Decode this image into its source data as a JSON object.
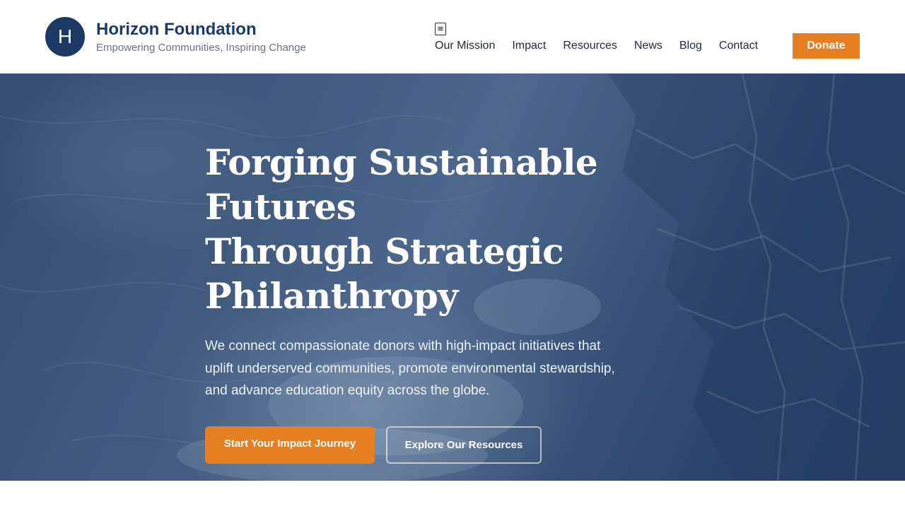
{
  "header": {
    "logo_letter": "H",
    "brand_name": "Horizon Foundation",
    "tagline": "Empowering Communities, Inspiring Change",
    "menu_toggle": "≡",
    "nav": [
      "Our Mission",
      "Impact",
      "Resources",
      "News",
      "Blog",
      "Contact"
    ],
    "donate_label": "Donate"
  },
  "hero": {
    "title_lines": [
      "Forging Sustainable Futures",
      "Through Strategic",
      "Philanthropy"
    ],
    "subtitle": "We connect compassionate donors with high-impact initiatives that uplift underserved communities, promote environmental stewardship, and advance education equity across the globe.",
    "primary_cta": "Start Your Impact Journey",
    "secondary_cta": "Explore Our Resources"
  },
  "colors": {
    "brand_navy": "#1b3a66",
    "accent_orange": "#e67e22",
    "hero_tint": "#3c5477"
  },
  "icons": {
    "menu_toggle": "hamburger-menu-icon"
  }
}
